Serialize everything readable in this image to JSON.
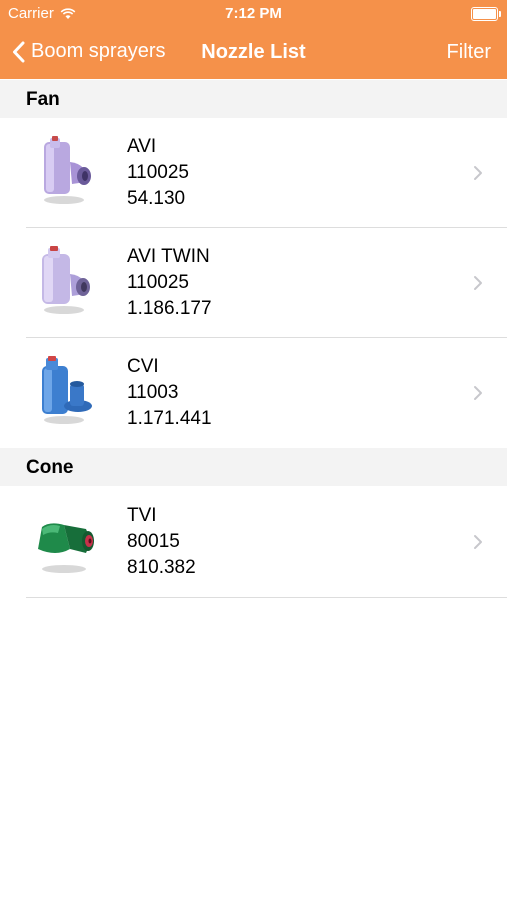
{
  "status_bar": {
    "carrier": "Carrier",
    "time": "7:12 PM"
  },
  "nav": {
    "back_label": "Boom sprayers",
    "title": "Nozzle List",
    "filter_label": "Filter"
  },
  "colors": {
    "accent": "#F5914A",
    "section_bg": "#F3F3F3",
    "chevron": "#C7C7CC",
    "separator": "#DDDDDD"
  },
  "sections": [
    {
      "title": "Fan",
      "items": [
        {
          "name": "AVI",
          "size": "110025",
          "code": "54.130",
          "icon": "purple-fan-nozzle-icon"
        },
        {
          "name": "AVI TWIN",
          "size": "110025",
          "code": "1.186.177",
          "icon": "purple-twin-nozzle-icon"
        },
        {
          "name": "CVI",
          "size": "11003",
          "code": "1.171.441",
          "icon": "blue-fan-nozzle-icon"
        }
      ]
    },
    {
      "title": "Cone",
      "items": [
        {
          "name": "TVI",
          "size": "80015",
          "code": "810.382",
          "icon": "green-cone-nozzle-icon"
        }
      ]
    }
  ]
}
